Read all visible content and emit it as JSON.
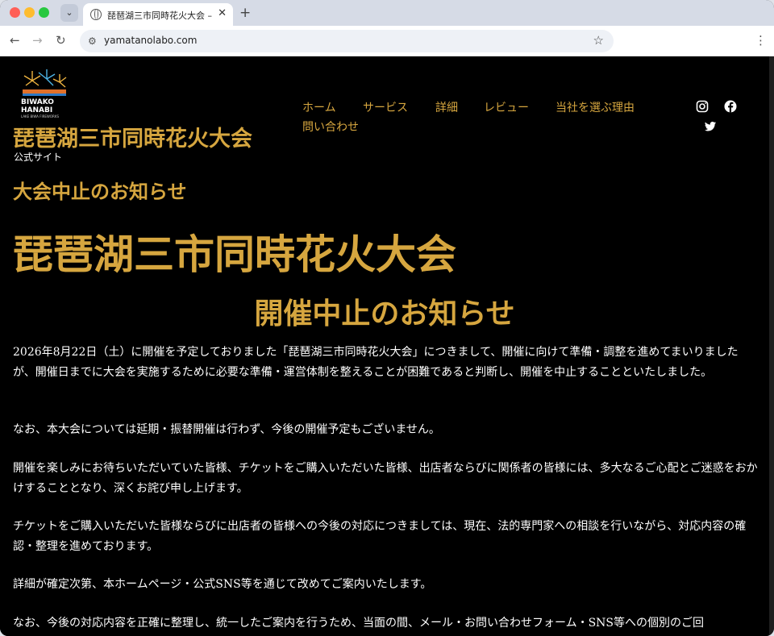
{
  "browser": {
    "tab_title": "琵琶湖三市同時花火大会 – 公式サ",
    "tab_close": "✕",
    "new_tab": "+",
    "url": "yamatanolabo.com"
  },
  "site": {
    "logo_line1": "BIWAKO",
    "logo_line2": "HANABI",
    "logo_line3": "LAKE BIWA FIREWORKS",
    "title": "琵琶湖三市同時花火大会",
    "tagline": "公式サイト"
  },
  "nav": {
    "items": [
      "ホーム",
      "サービス",
      "詳細",
      "レビュー",
      "当社を選ぶ理由",
      "問い合わせ"
    ]
  },
  "social": {
    "icons": [
      "instagram-icon",
      "facebook-icon",
      "twitter-icon"
    ]
  },
  "content": {
    "notice_heading": "大会中止のお知らせ",
    "event_name": "琵琶湖三市同時花火大会",
    "cancel_heading": "開催中止のお知らせ",
    "paragraphs": [
      "2026年8月22日（土）に開催を予定しておりました「琵琶湖三市同時花火大会」につきまして、開催に向けて準備・調整を進めてまいりましたが、開催日までに大会を実施するために必要な準備・運営体制を整えることが困難であると判断し、開催を中止することといたしました。",
      "なお、本大会については延期・振替開催は行わず、今後の開催予定もございません。",
      "開催を楽しみにお待ちいただいていた皆様、チケットをご購入いただいた皆様、出店者ならびに関係者の皆様には、多大なるご心配とご迷惑をおかけすることとなり、深くお詫び申し上げます。",
      "チケットをご購入いただいた皆様ならびに出店者の皆様への今後の対応につきましては、現在、法的専門家への相談を行いながら、対応内容の確認・整理を進めております。",
      "詳細が確定次第、本ホームページ・公式SNS等を通じて改めてご案内いたします。",
      "なお、今後の対応内容を正確に整理し、統一したご案内を行うため、当面の間、メール・お問い合わせフォーム・SNS等への個別のご回"
    ]
  }
}
